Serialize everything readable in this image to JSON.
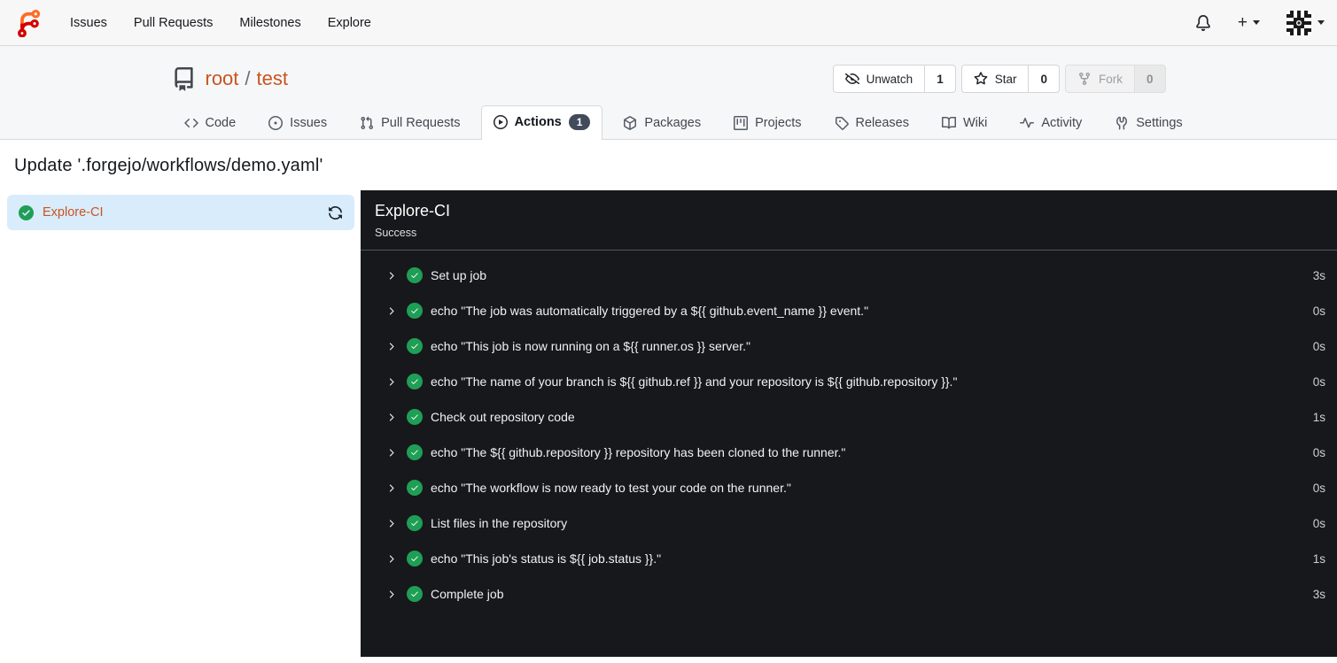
{
  "navbar": {
    "items": [
      "Issues",
      "Pull Requests",
      "Milestones",
      "Explore"
    ],
    "new_button_label": "+",
    "icons": {
      "logo": "forgejo-logo",
      "notifications": "bell-icon",
      "profile": "identicon-avatar"
    }
  },
  "repo": {
    "owner": "root",
    "separator": "/",
    "name": "test",
    "actions": [
      {
        "label": "Unwatch",
        "count": "1",
        "icon": "eye-slash-icon",
        "disabled": false
      },
      {
        "label": "Star",
        "count": "0",
        "icon": "star-icon",
        "disabled": false
      },
      {
        "label": "Fork",
        "count": "0",
        "icon": "fork-icon",
        "disabled": true
      }
    ],
    "tabs": [
      {
        "label": "Code",
        "icon": "code-icon"
      },
      {
        "label": "Issues",
        "icon": "issue-icon"
      },
      {
        "label": "Pull Requests",
        "icon": "pull-request-icon"
      },
      {
        "label": "Actions",
        "icon": "play-circle-icon",
        "badge": "1",
        "active": true
      },
      {
        "label": "Packages",
        "icon": "package-icon"
      },
      {
        "label": "Projects",
        "icon": "project-icon"
      },
      {
        "label": "Releases",
        "icon": "tag-icon"
      },
      {
        "label": "Wiki",
        "icon": "book-icon"
      },
      {
        "label": "Activity",
        "icon": "pulse-icon"
      },
      {
        "label": "Settings",
        "icon": "tools-icon"
      }
    ]
  },
  "page": {
    "title": "Update '.forgejo/workflows/demo.yaml'"
  },
  "run": {
    "job_name": "Explore-CI",
    "job_status_icon": "check-circle-icon",
    "panel_title": "Explore-CI",
    "panel_status": "Success",
    "steps": [
      {
        "title": "Set up job",
        "duration": "3s"
      },
      {
        "title": "echo \"The job was automatically triggered by a ${{ github.event_name }} event.\"",
        "duration": "0s"
      },
      {
        "title": "echo \"This job is now running on a ${{ runner.os }} server.\"",
        "duration": "0s"
      },
      {
        "title": "echo \"The name of your branch is ${{ github.ref }} and your repository is ${{ github.repository }}.\"",
        "duration": "0s"
      },
      {
        "title": "Check out repository code",
        "duration": "1s"
      },
      {
        "title": "echo \"The ${{ github.repository }} repository has been cloned to the runner.\"",
        "duration": "0s"
      },
      {
        "title": "echo \"The workflow is now ready to test your code on the runner.\"",
        "duration": "0s"
      },
      {
        "title": "List files in the repository",
        "duration": "0s"
      },
      {
        "title": "echo \"This job's status is ${{ job.status }}.\"",
        "duration": "1s"
      },
      {
        "title": "Complete job",
        "duration": "3s"
      }
    ]
  },
  "colors": {
    "accent_link": "#c8541f",
    "success_green": "#1f9e56",
    "panel_background": "#17181b",
    "panel_divider": "#4d5768",
    "job_item_background": "#d8ecfb",
    "tab_badge_background": "#414b5a",
    "header_background": "#f6f7f8"
  }
}
